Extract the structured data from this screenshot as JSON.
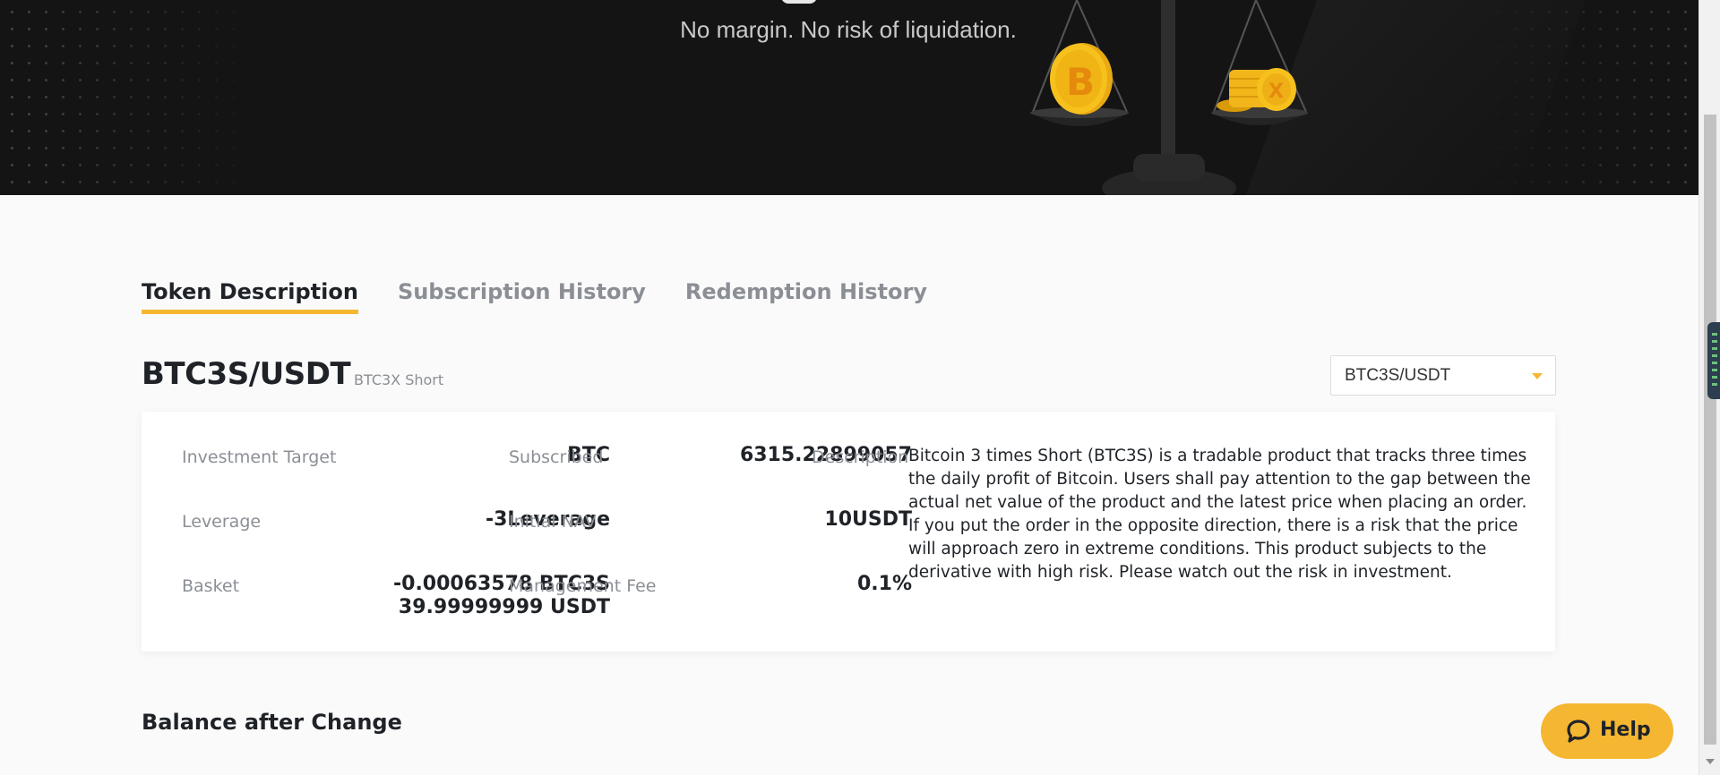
{
  "hero": {
    "subtitle": "No margin. No risk of liquidation."
  },
  "tabs": [
    {
      "label": "Token Description",
      "active": true
    },
    {
      "label": "Subscription History",
      "active": false
    },
    {
      "label": "Redemption History",
      "active": false
    }
  ],
  "pair": {
    "title": "BTC3S/USDT",
    "subtitle": "BTC3X Short",
    "selected": "BTC3S/USDT"
  },
  "details": {
    "investment_target": {
      "label": "Investment Target",
      "value": "BTC"
    },
    "leverage": {
      "label": "Leverage",
      "value": "-3Leverage"
    },
    "basket": {
      "label": "Basket",
      "value_line1": "-0.00063578 BTC3S",
      "value_line2": "39.99999999 USDT"
    },
    "subscribed": {
      "label": "Subscribed",
      "value": "6315.22899057"
    },
    "initial_nav": {
      "label": "Initial NAV",
      "value": "10USDT"
    },
    "management_fee": {
      "label": "Management Fee",
      "value": "0.1%"
    },
    "description": {
      "label": "Description",
      "value": "Bitcoin 3 times Short (BTC3S) is a tradable product that tracks three times the daily profit of Bitcoin. Users shall pay attention to the gap between the actual net value of the product and the latest price when placing an order. If you put the order in the opposite direction, there is a risk that the price will approach zero in extreme conditions. This product subjects to the derivative with high risk. Please watch out the risk in investment."
    }
  },
  "balance_section_title": "Balance after Change",
  "help_button": {
    "label": "Help",
    "icon": "chat-bubble-icon"
  },
  "colors": {
    "accent": "#f5b731",
    "hero_bg": "#141414",
    "text": "#1f2328",
    "muted": "#8b8f95"
  }
}
